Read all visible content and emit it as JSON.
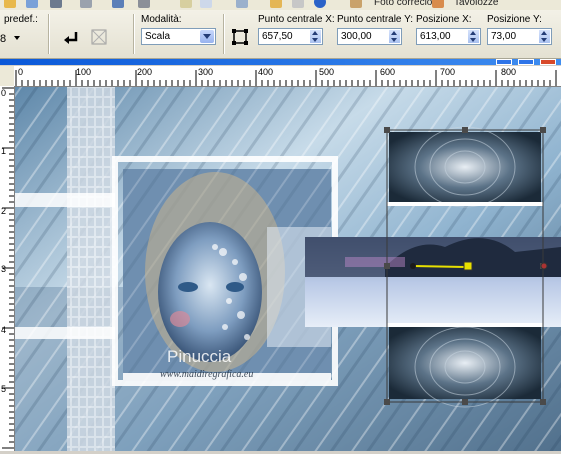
{
  "menu_partial": {
    "item1": "Foto correcio",
    "item2": "Tavolozze"
  },
  "toolbar": {
    "preset_label": "predef.:",
    "mode_label": "Modalità:",
    "mode_value": "Scala",
    "center_x_label": "Punto centrale X:",
    "center_x_value": "657,50",
    "center_y_label": "Punto centrale Y:",
    "center_y_value": "300,00",
    "pos_x_label": "Posizione X:",
    "pos_x_value": "613,00",
    "pos_y_label": "Posizione Y:",
    "pos_y_value": "73,00"
  },
  "ruler": {
    "h_labels": [
      "0",
      "100",
      "200",
      "300",
      "400",
      "500",
      "600",
      "700",
      "800"
    ],
    "v_labels": [
      "0",
      "1",
      "2",
      "3",
      "4",
      "5"
    ]
  },
  "canvas": {
    "watermark_title": "Pinuccia",
    "watermark_url": "www.maidiregrafica.eu"
  },
  "colors": {
    "titlebar": "#0a58d8",
    "selection_box": "#3a3a3a",
    "pivot_line": "#e8e000"
  }
}
